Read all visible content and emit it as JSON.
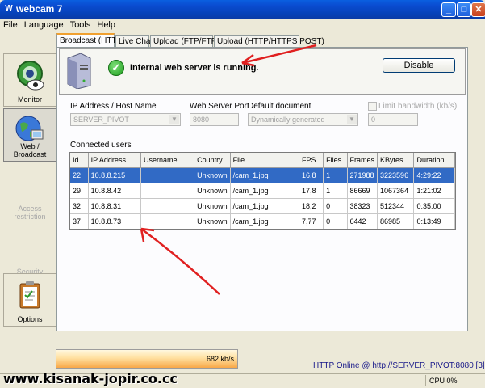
{
  "window": {
    "title": "webcam 7",
    "icon_glyph": "W",
    "min": "_",
    "max": "□",
    "close": "✕"
  },
  "menu": [
    "File",
    "Language",
    "Tools",
    "Help"
  ],
  "sidebar": {
    "items": [
      {
        "label": "Monitor",
        "icon": "monitor-eye-icon"
      },
      {
        "label": "Web / Broadcast",
        "icon": "globe-icon"
      },
      {
        "label": "Access restriction",
        "icon": ""
      },
      {
        "label": "Security",
        "icon": ""
      },
      {
        "label": "Options",
        "icon": "clipboard-icon"
      }
    ]
  },
  "tabs": [
    "Broadcast (HTTP)",
    "Live Chat",
    "Upload (FTP/FTPS)",
    "Upload (HTTP/HTTPS POST)"
  ],
  "status": {
    "message": "Internal web server is running.",
    "disable_label": "Disable"
  },
  "form": {
    "ip_label": "IP Address / Host Name",
    "ip_value": "SERVER_PIVOT",
    "port_label": "Web Server Port",
    "port_value": "8080",
    "doc_label": "Default document",
    "doc_value": "Dynamically generated",
    "limit_label": "Limit bandwidth (kb/s)",
    "limit_value": "0"
  },
  "users": {
    "heading": "Connected users",
    "columns": [
      "Id",
      "IP Address",
      "Username",
      "Country",
      "File",
      "FPS",
      "Files",
      "Frames",
      "KBytes",
      "Duration"
    ],
    "rows": [
      [
        "22",
        "10.8.8.215",
        "",
        "Unknown",
        "/cam_1.jpg",
        "16,8",
        "1",
        "271988",
        "3223596",
        "4:29:22"
      ],
      [
        "29",
        "10.8.8.42",
        "",
        "Unknown",
        "/cam_1.jpg",
        "17,8",
        "1",
        "86669",
        "1067364",
        "1:21:02"
      ],
      [
        "32",
        "10.8.8.31",
        "",
        "Unknown",
        "/cam_1.jpg",
        "18,2",
        "0",
        "38323",
        "512344",
        "0:35:00"
      ],
      [
        "37",
        "10.8.8.73",
        "",
        "Unknown",
        "/cam_1.jpg",
        "7,77",
        "0",
        "6442",
        "86985",
        "0:13:49"
      ]
    ]
  },
  "bandwidth": "682 kb/s",
  "http_status": "HTTP Online @ http://SERVER_PIVOT:8080 [3]",
  "statusbar": {
    "cpu": "CPU 0%"
  },
  "watermark": "www.kisanak-jopir.co.cc",
  "colors": {
    "selection": "#316ac5",
    "titlebar": "#0a4bd0",
    "arrow": "#e02020",
    "graph": "#f8a848"
  }
}
